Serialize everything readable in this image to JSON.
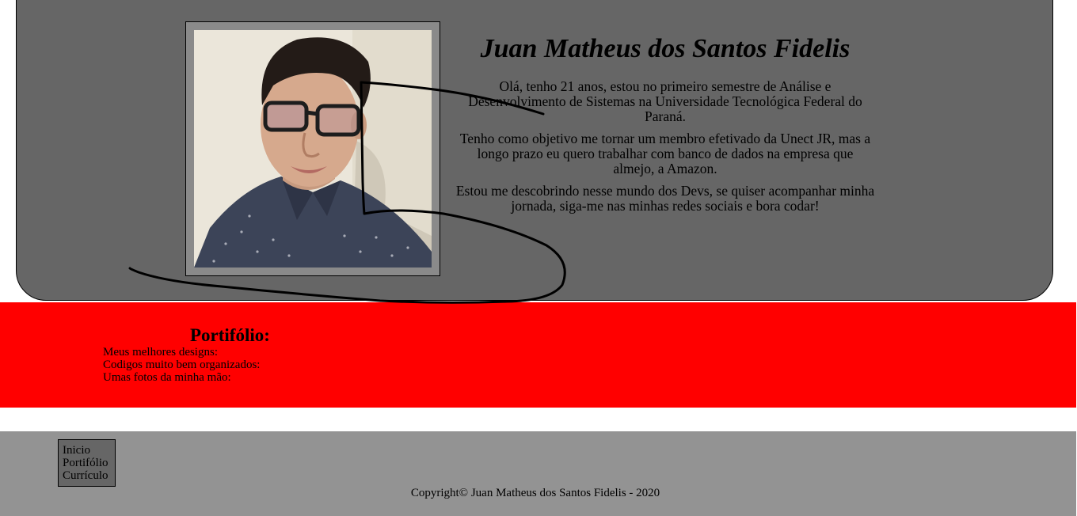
{
  "colors": {
    "hero_bg": "#666666",
    "portfolio_bg": "#ff0000",
    "footer_bg": "#939393",
    "nav_bg": "#666666"
  },
  "hero": {
    "name": "Juan Matheus dos Santos Fidelis",
    "paragraphs": [
      "Olá, tenho 21 anos, estou no primeiro semestre de Análise e Desenvolvimento de Sistemas na Universidade Tecnológica Federal do Paraná.",
      "Tenho como objetivo me tornar um membro efetivado da Unect JR, mas a longo prazo eu quero trabalhar com banco de dados na empresa que almejo, a Amazon.",
      "Estou me descobrindo nesse mundo dos Devs, se quiser acompanhar minha jornada, siga-me nas minhas redes sociais e bora codar!"
    ]
  },
  "portfolio": {
    "title": "Portifólio:",
    "items": [
      "Meus melhores designs:",
      "Codigos muito bem organizados:",
      "Umas fotos da minha mão:"
    ]
  },
  "footer": {
    "nav": [
      "Inicio",
      "Portifólio",
      "Currículo"
    ],
    "copyright": "Copyright© Juan Matheus dos Santos Fidelis - 2020"
  }
}
